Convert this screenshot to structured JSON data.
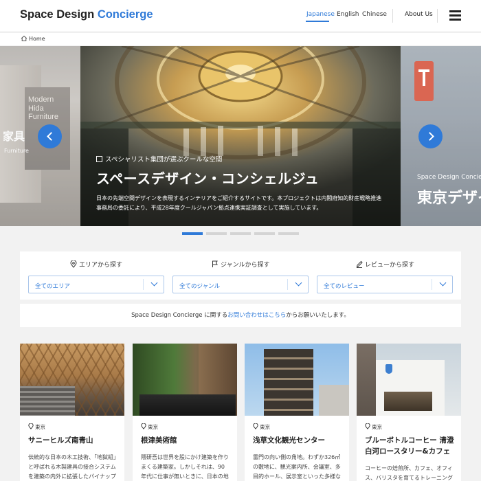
{
  "header": {
    "logo_main": "Space Design",
    "logo_accent": "Concierge",
    "languages": [
      "Japanese",
      "English",
      "Chinese"
    ],
    "about": "About Us"
  },
  "breadcrumb": {
    "home": "Home"
  },
  "hero": {
    "subtitle": "スペシャリスト集団が選ぶクールな空間",
    "title": "スペースデザイン・コンシェルジュ",
    "description": "日本の先端空間デザインを表現するインテリアをご紹介するサイトです。本プロジェクトは内閣府知的財産戦略推進事務局の委託により、平成28年度クールジャパン拠点連携実証調査として実施しています。",
    "left_slide": {
      "sign_text": "Modern Hida Furniture",
      "kanji": "家具",
      "small": "Furniture"
    },
    "right_slide": {
      "subtitle": "Space Design Concierge",
      "title": "東京デザイ"
    },
    "slide_count": 5,
    "active_slide": 1
  },
  "search": {
    "area_label": "エリアから探す",
    "genre_label": "ジャンルから探す",
    "review_label": "レビューから探す",
    "area_value": "全てのエリア",
    "genre_value": "全てのジャンル",
    "review_value": "全てのレビュー"
  },
  "contact": {
    "prefix": "Space Design Concierge に関する",
    "link": "お問い合わせはこちら",
    "suffix": "からお願いいたします。"
  },
  "cards": [
    {
      "area": "東京",
      "name": "サニーヒルズ南青山",
      "desc": "伝統的な日本の木工技術、「地獄組」と呼ばれる木製建具の接合システムを建築の内外に拡張したパイナップ"
    },
    {
      "area": "東京",
      "name": "根津美術館",
      "desc": "隈研吾は世界を股にかけ建築を作りまくる建築家。しかしそれは、90年代に仕事が無いときに、日本の地方の小さ"
    },
    {
      "area": "東京",
      "name": "浅草文化観光センター",
      "desc": "雷門の向い側の角地。わずか326㎡の敷地に、観光案内所、会議室、多目的ホール、展示室といった多様なプロ"
    },
    {
      "area": "東京",
      "name": "ブルーボトルコーヒー 清澄白河ロースタリー&カフェ",
      "desc": "コーヒーの焙煎所、カフェ、オフィス、バリスタを育てるトレーニングルームと"
    }
  ]
}
